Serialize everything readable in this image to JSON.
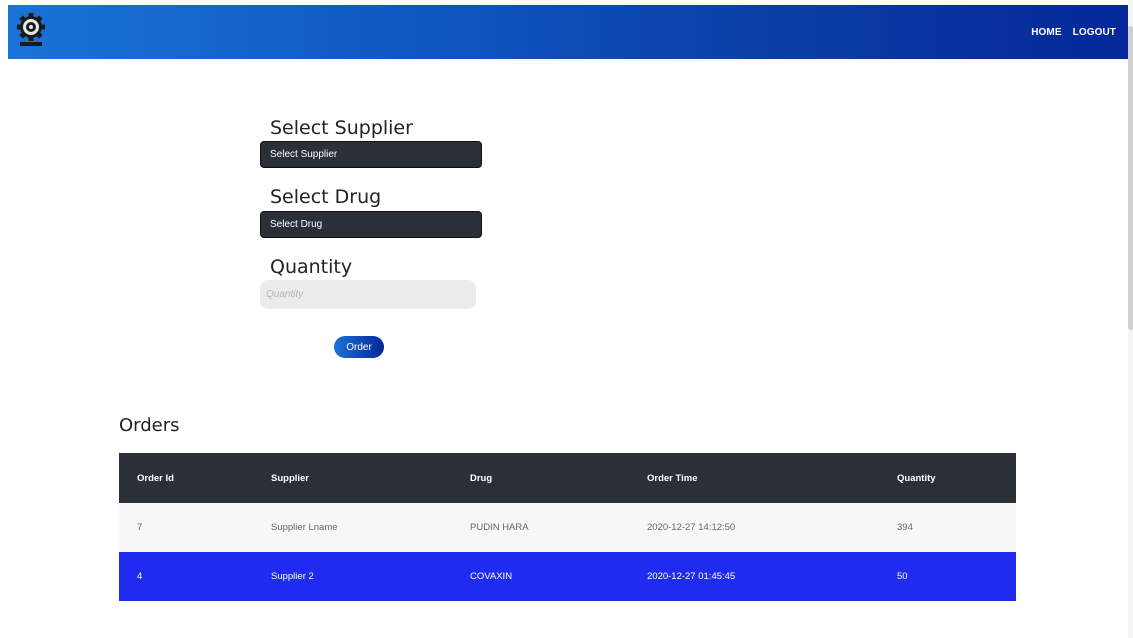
{
  "nav": {
    "links": [
      "HOME",
      "LOGOUT"
    ]
  },
  "form": {
    "supplier_label": "Select Supplier",
    "supplier_value": "Select Supplier",
    "drug_label": "Select Drug",
    "drug_value": "Select Drug",
    "quantity_label": "Quantity",
    "quantity_placeholder": "Quantity",
    "order_button": "Order"
  },
  "orders": {
    "title": "Orders",
    "columns": [
      "Order Id",
      "Supplier",
      "Drug",
      "Order Time",
      "Quantity"
    ],
    "rows": [
      [
        "7",
        "Supplier Lname",
        "PUDIN HARA",
        "2020-12-27 14:12:50",
        "394"
      ],
      [
        "4",
        "Supplier 2",
        "COVAXIN",
        "2020-12-27 01:45:45",
        "50"
      ]
    ]
  },
  "colors": {
    "navbar_gradient": [
      "#1a73d6",
      "#05279a"
    ],
    "dark_control": "#2b2f38",
    "highlight_row": "#1f2cf0"
  },
  "icons": [
    "gear-logo-icon"
  ]
}
